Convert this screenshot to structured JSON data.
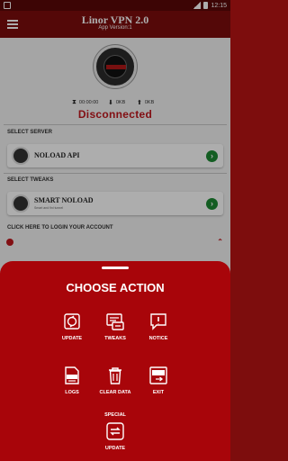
{
  "statusbar": {
    "time": "12:15"
  },
  "toolbar": {
    "title": "Linor VPN 2.0",
    "subtitle": "App Version:1"
  },
  "stats": {
    "timer": "00:00:00",
    "down": "0KB",
    "up": "0KB"
  },
  "status": {
    "text": "Disconnected",
    "color": "#c0171d"
  },
  "server": {
    "section_label": "SELECT SERVER",
    "name": "NOLOAD API"
  },
  "tweaks": {
    "section_label": "SELECT TWEAKS",
    "name": "SMART NOLOAD",
    "description": "Smart and fini tunnel"
  },
  "login": {
    "text": "CLICK HERE TO LOGIN YOUR ACCOUNT"
  },
  "sheet": {
    "title": "CHOOSE ACTION",
    "actions": [
      {
        "label": "UPDATE",
        "icon": "update-icon"
      },
      {
        "label": "TWEAKS",
        "icon": "tweaks-icon"
      },
      {
        "label": "NOTICE",
        "icon": "notice-icon"
      },
      {
        "label": "LOGS",
        "icon": "logs-icon"
      },
      {
        "label": "CLEAR DATA",
        "icon": "trash-icon"
      },
      {
        "label": "EXIT",
        "icon": "exit-icon"
      }
    ],
    "special": {
      "top_label": "SPECIAL",
      "label": "UPDATE",
      "icon": "refresh-icon"
    }
  },
  "colors": {
    "primary": "#7d0d0d",
    "sheet": "#a8050a",
    "accent_green": "#1c8a33"
  }
}
